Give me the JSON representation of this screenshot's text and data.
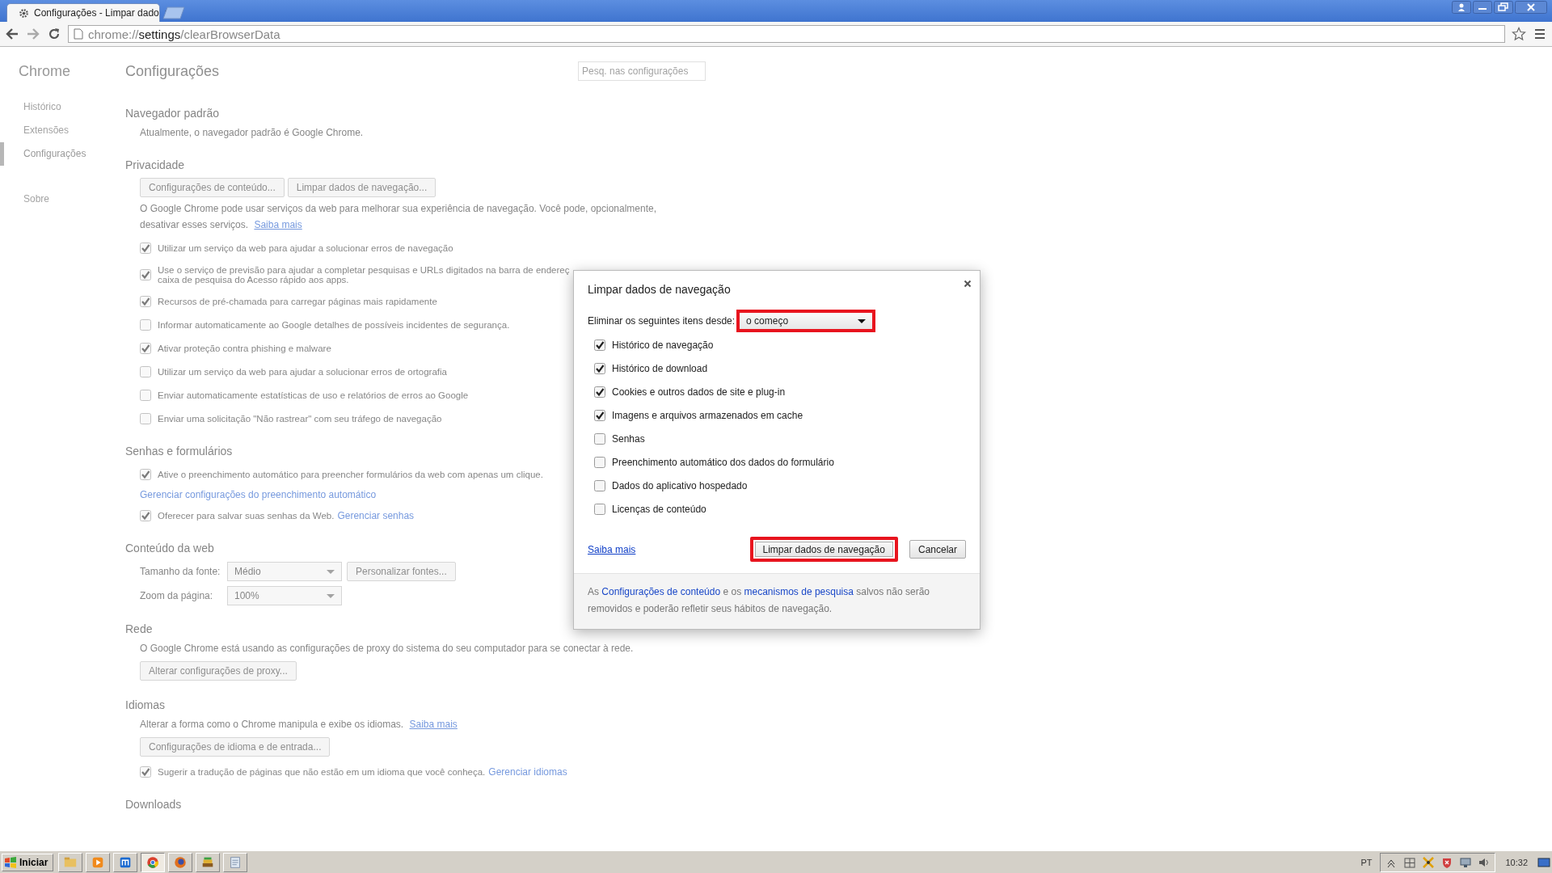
{
  "browser": {
    "tab": {
      "title": "Configurações - Limpar dado",
      "selected": true
    },
    "address": {
      "scheme": "chrome://",
      "host": "settings",
      "path": "/clearBrowserData"
    }
  },
  "settings": {
    "sidebar": {
      "title": "Chrome",
      "items": [
        {
          "label": "Histórico",
          "selected": false
        },
        {
          "label": "Extensões",
          "selected": false
        },
        {
          "label": "Configurações",
          "selected": true
        },
        {
          "label": "Sobre",
          "selected": false
        }
      ]
    },
    "title": "Configurações",
    "search": {
      "placeholder": "Pesq. nas configurações"
    },
    "sections": [
      {
        "heading": "Navegador padrão",
        "items": [
          {
            "kind": "text",
            "text": "Atualmente, o navegador padrão é Google Chrome."
          }
        ]
      },
      {
        "heading": "Privacidade",
        "items": [
          {
            "kind": "buttons",
            "buttons": [
              "Configurações de conteúdo...",
              "Limpar dados de navegação..."
            ]
          },
          {
            "kind": "text",
            "text": "O Google Chrome pode usar serviços da web para melhorar sua experiência de navegação. Você pode, opcionalmente, desativar esses serviços.",
            "link": "Saiba mais"
          },
          {
            "kind": "checkbox",
            "label": "Utilizar um serviço da web para ajudar a solucionar erros de navegação",
            "checked": true
          },
          {
            "kind": "checkbox",
            "label": "Use o serviço de previsão para ajudar a completar pesquisas e URLs digitados na barra de endereç",
            "label_2": "caixa de pesquisa do Acesso rápido aos apps.",
            "checked": true
          },
          {
            "kind": "checkbox",
            "label": "Recursos de pré-chamada para carregar páginas mais rapidamente",
            "checked": true
          },
          {
            "kind": "checkbox",
            "label": "Informar automaticamente ao Google detalhes de possíveis incidentes de segurança.",
            "checked": false
          },
          {
            "kind": "checkbox",
            "label": "Ativar proteção contra phishing e malware",
            "checked": true
          },
          {
            "kind": "checkbox",
            "label": "Utilizar um serviço da web para ajudar a solucionar erros de ortografia",
            "checked": false
          },
          {
            "kind": "checkbox",
            "label": "Enviar automaticamente estatísticas de uso e relatórios de erros ao Google",
            "checked": false
          },
          {
            "kind": "checkbox",
            "label": "Enviar uma solicitação \"Não rastrear\" com seu tráfego de navegação",
            "checked": false
          }
        ]
      },
      {
        "heading": "Senhas e formulários",
        "items": [
          {
            "kind": "checkbox",
            "label": "Ative o preenchimento automático para preencher formulários da web com apenas um clique.",
            "checked": true
          },
          {
            "kind": "link",
            "text": "Gerenciar configurações do preenchimento automático"
          },
          {
            "kind": "checkbox",
            "label": "Oferecer para salvar suas senhas da Web.",
            "link": "Gerenciar senhas",
            "checked": true
          }
        ]
      },
      {
        "heading": "Conteúdo da web",
        "items": [
          {
            "kind": "select",
            "label": "Tamanho da fonte:",
            "value": "Médio",
            "button": "Personalizar fontes..."
          },
          {
            "kind": "select",
            "label": "Zoom da página:",
            "value": "100%"
          }
        ]
      },
      {
        "heading": "Rede",
        "items": [
          {
            "kind": "text",
            "text": "O Google Chrome está usando as configurações de proxy do sistema do seu computador para se conectar à rede."
          },
          {
            "kind": "buttons",
            "buttons": [
              "Alterar configurações de proxy..."
            ]
          }
        ]
      },
      {
        "heading": "Idiomas",
        "items": [
          {
            "kind": "text",
            "text": "Alterar a forma como o Chrome manipula e exibe os idiomas.",
            "link": "Saiba mais"
          },
          {
            "kind": "buttons",
            "buttons": [
              "Configurações de idioma e de entrada..."
            ]
          },
          {
            "kind": "checkbox",
            "label": "Sugerir a tradução de páginas que não estão em um idioma que você conheça.",
            "link": "Gerenciar idiomas",
            "checked": true
          }
        ]
      },
      {
        "heading": "Downloads"
      }
    ]
  },
  "dialog": {
    "title": "Limpar dados de navegação",
    "range_label": "Eliminar os seguintes itens desde:",
    "range": {
      "value": "o começo",
      "highlighted": true
    },
    "items": [
      {
        "label": "Histórico de navegação",
        "checked": true
      },
      {
        "label": "Histórico de download",
        "checked": true
      },
      {
        "label": "Cookies e outros dados de site e plug-in",
        "checked": true
      },
      {
        "label": "Imagens e arquivos armazenados em cache",
        "checked": true
      },
      {
        "label": "Senhas",
        "checked": false
      },
      {
        "label": "Preenchimento automático dos dados do formulário",
        "checked": false
      },
      {
        "label": "Dados do aplicativo hospedado",
        "checked": false
      },
      {
        "label": "Licenças de conteúdo",
        "checked": false
      }
    ],
    "learn_more": "Saiba mais",
    "clear_button": {
      "label": "Limpar dados de navegação",
      "highlighted": true
    },
    "cancel_button": "Cancelar",
    "footer": [
      {
        "kind": "plain",
        "text": "As"
      },
      {
        "kind": "link",
        "text": "Configurações de conteúdo"
      },
      {
        "kind": "plain",
        "text": "e os"
      },
      {
        "kind": "link",
        "text": "mecanismos de pesquisa"
      },
      {
        "kind": "plain",
        "text": "salvos não serão removidos e poderão refletir seus hábitos de navegação."
      }
    ]
  },
  "taskbar": {
    "start": "Iniciar",
    "language": "PT",
    "clock": "10:32"
  }
}
